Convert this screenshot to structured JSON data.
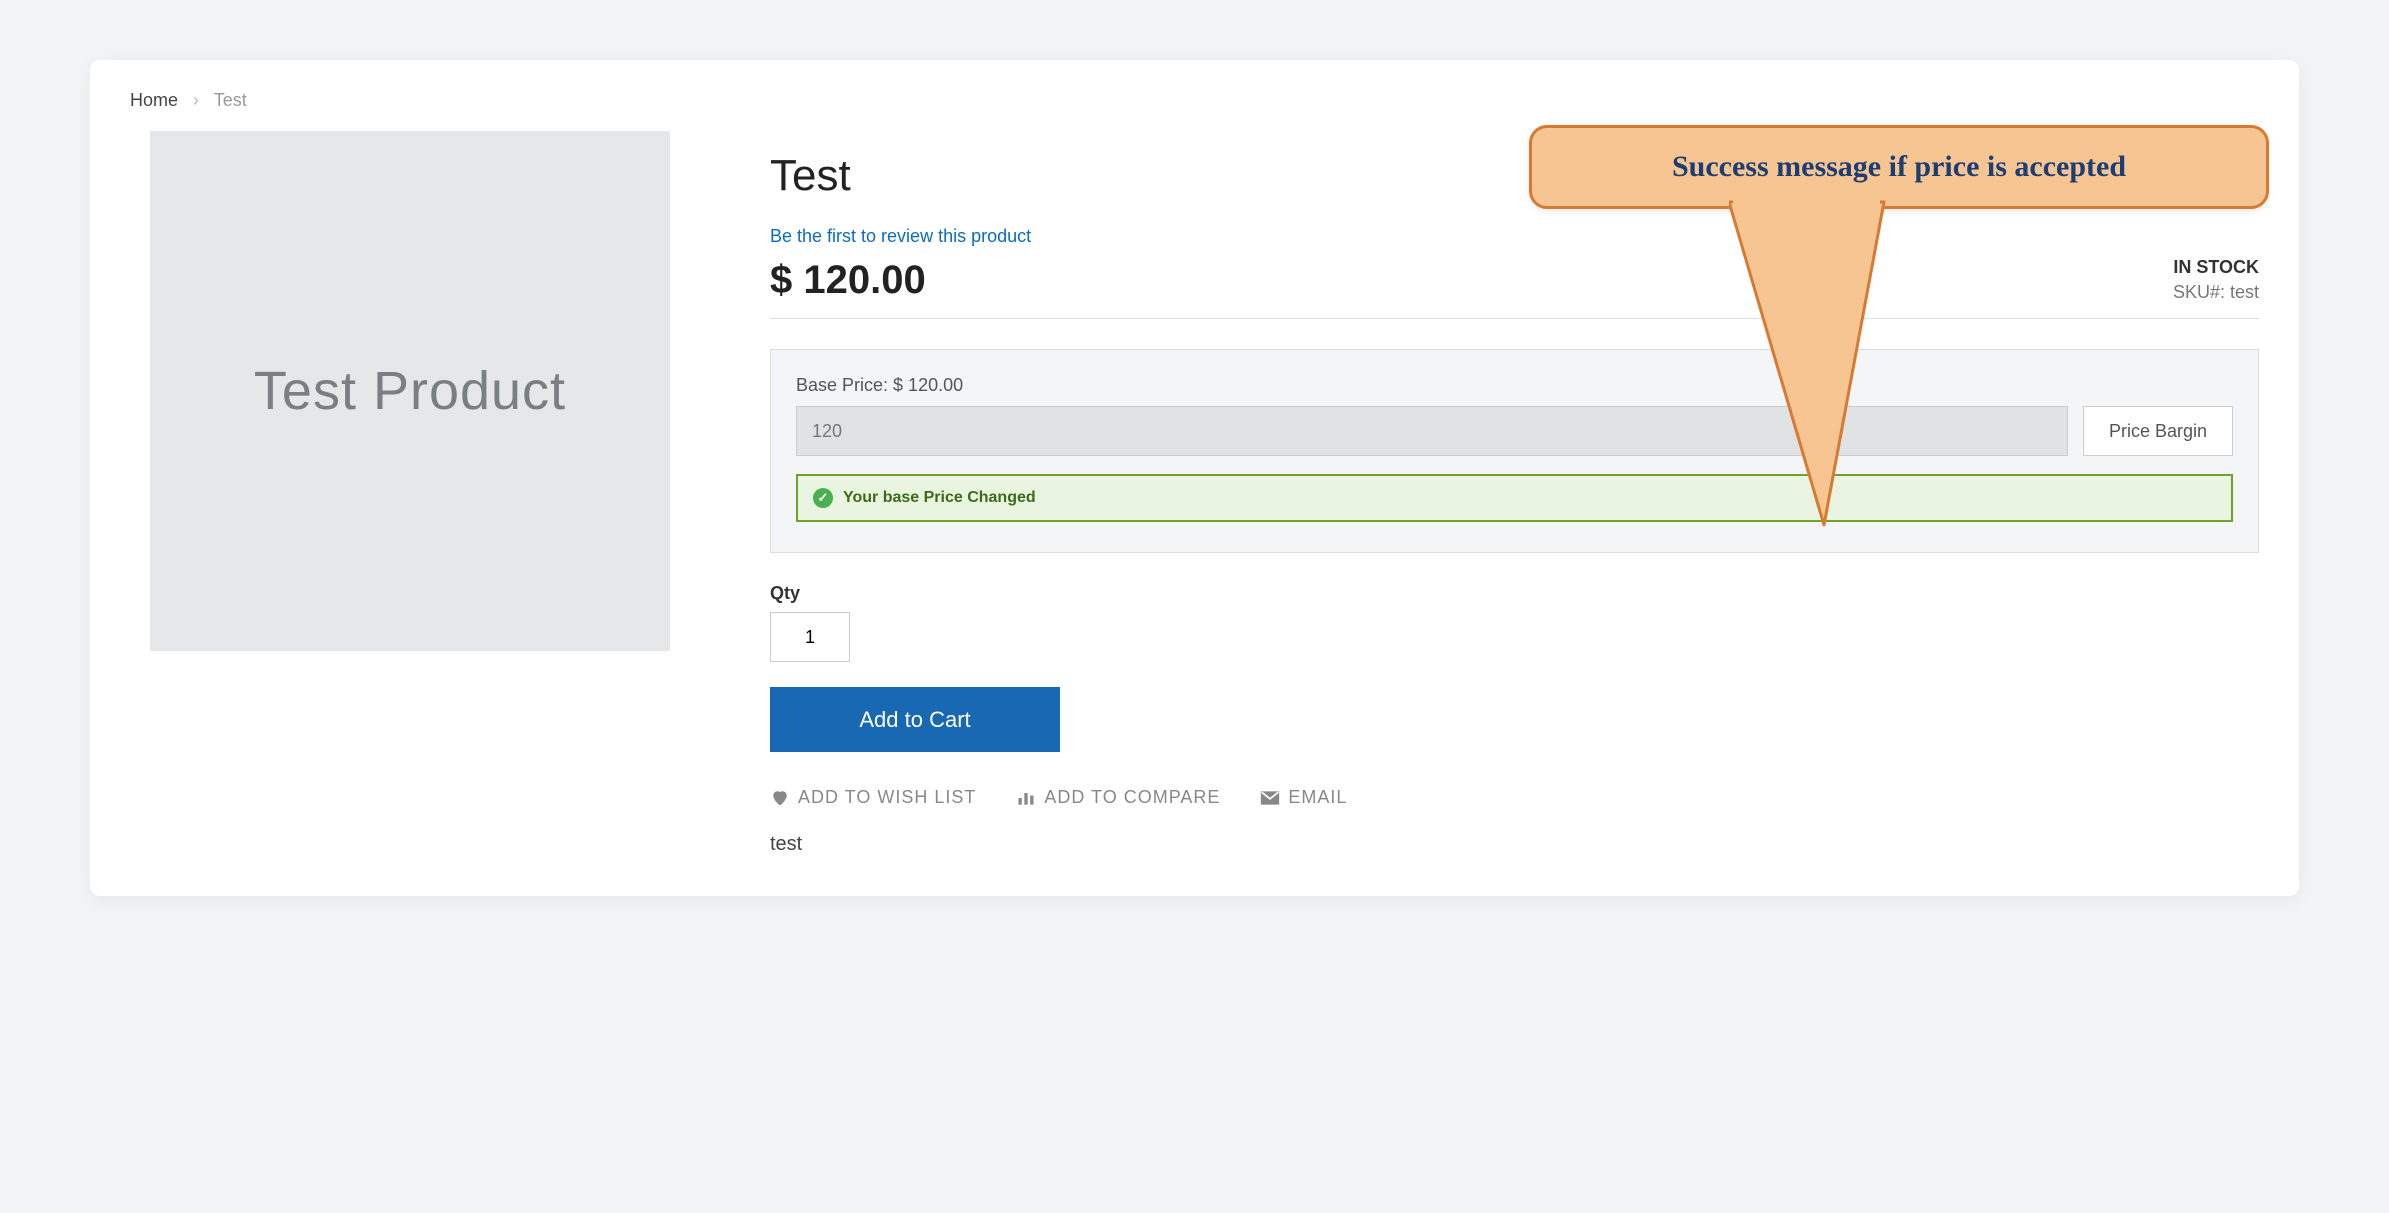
{
  "breadcrumb": {
    "home": "Home",
    "current": "Test"
  },
  "product": {
    "image_placeholder": "Test Product",
    "title": "Test",
    "review_link": "Be the first to review this product",
    "price": "$ 120.00",
    "stock_status": "IN STOCK",
    "sku_label": "SKU#:",
    "sku_value": "test",
    "description": "test"
  },
  "bargain": {
    "base_price_label": "Base Price: $ 120.00",
    "input_value": "120",
    "button_label": "Price Bargin",
    "success_message": "Your base Price Changed"
  },
  "cart": {
    "qty_label": "Qty",
    "qty_value": "1",
    "add_button": "Add to Cart"
  },
  "actions": {
    "wishlist": "ADD TO WISH LIST",
    "compare": "ADD TO COMPARE",
    "email": "EMAIL"
  },
  "annotation": {
    "text": "Success message if price is accepted"
  }
}
